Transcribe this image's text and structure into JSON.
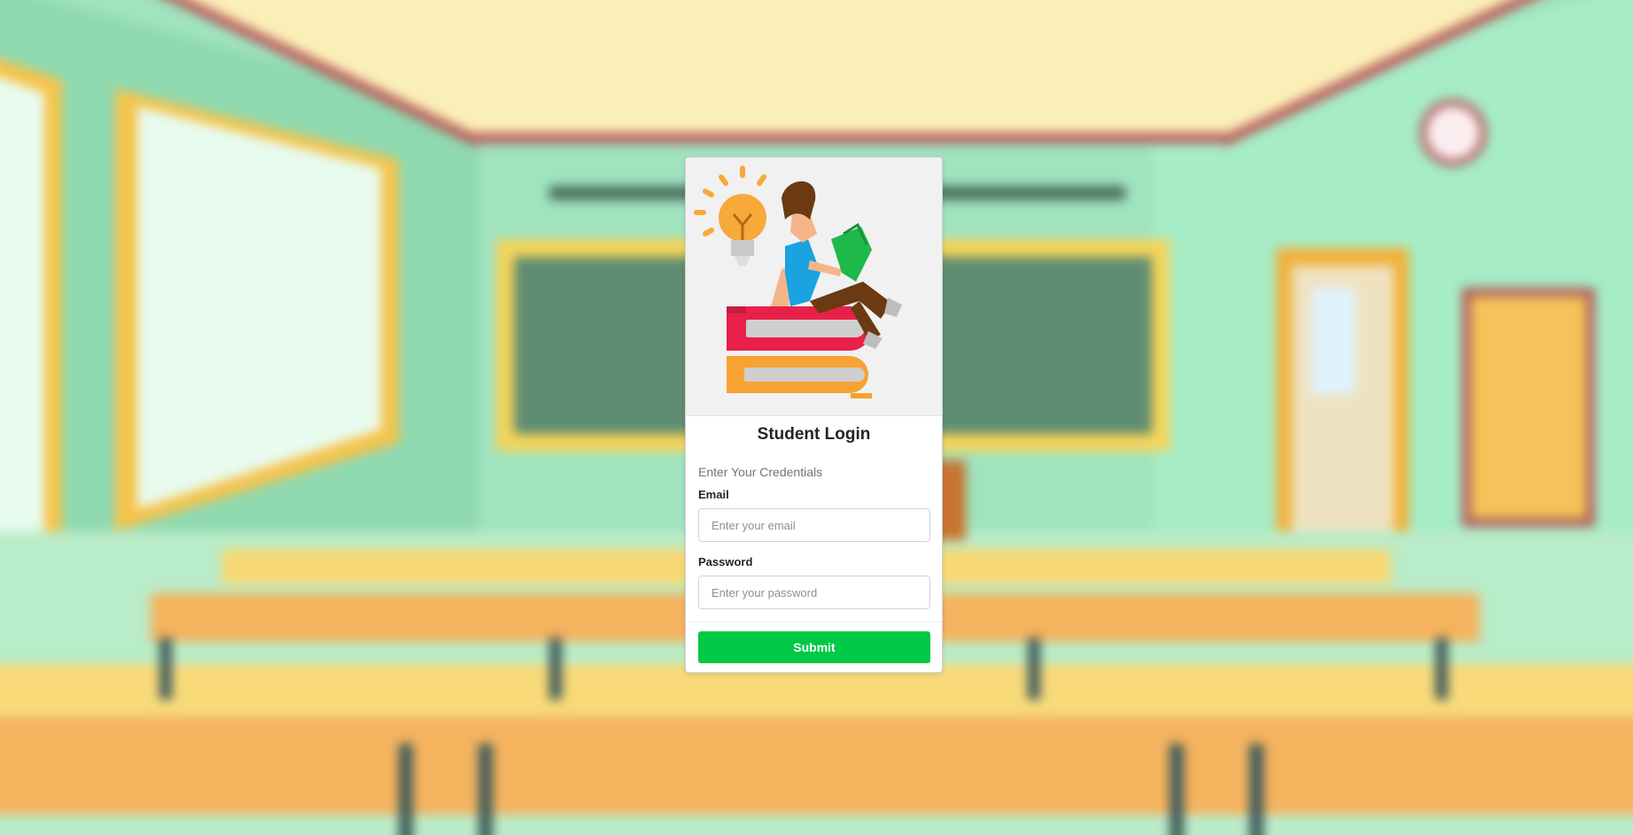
{
  "login": {
    "title": "Student Login",
    "subtitle": "Enter Your Credentials",
    "email_label": "Email",
    "email_placeholder": "Enter your email",
    "email_value": "",
    "password_label": "Password",
    "password_placeholder": "Enter your password",
    "password_value": "",
    "submit_label": "Submit"
  },
  "colors": {
    "submit": "#00c946",
    "wall": "#9fe6c0",
    "chalkboard": "#5e8a72",
    "desk": "#f5b35e"
  },
  "icons": {
    "hero": "student-reading-on-books-illustration",
    "lightbulb": "lightbulb-icon"
  }
}
